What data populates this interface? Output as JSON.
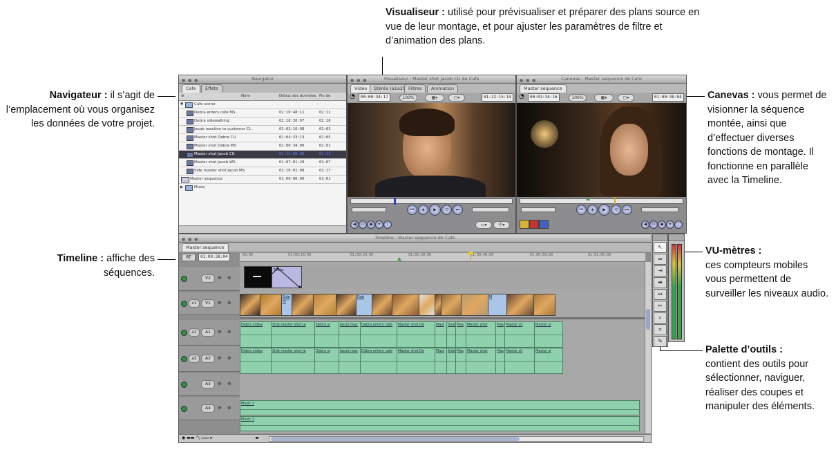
{
  "callouts": {
    "visualiseur": {
      "title": "Visualiseur :",
      "text": "utilisé pour prévisualiser et préparer des plans source en vue de leur montage, et pour ajuster les paramètres de filtre et d’animation des plans."
    },
    "navigateur": {
      "title": "Navigateur :",
      "text": "il s’agit de l’emplacement où vous organisez les données de votre projet."
    },
    "canevas": {
      "title": "Canevas :",
      "text": "vous permet de visionner la séquence montée, ainsi que d’effectuer diverses fonctions de montage. Il fonctionne en parallèle avec la Timeline."
    },
    "timeline": {
      "title": "Timeline :",
      "text": "affiche des séquences."
    },
    "vumetres": {
      "title": "VU-mètres :",
      "text": "ces compteurs mobiles vous permettent de surveiller les niveaux audio."
    },
    "palette": {
      "title": "Palette d’outils :",
      "text": "contient des outils pour sélectionner, naviguer, réaliser des coupes et manipuler des éléments."
    }
  },
  "browser": {
    "title": "Navigator",
    "tabs": [
      "Cafe",
      "Effets"
    ],
    "columns": {
      "name": "Nom",
      "date": "Début des données",
      "fin": "Fin de"
    },
    "bin_name": "Cafe scene",
    "rows": [
      {
        "name": "Debra enters cafe MS",
        "start": "02:10:48:11",
        "end": "02:11"
      },
      {
        "name": "Debra sidewalking",
        "start": "02:18:30:07",
        "end": "02:18"
      },
      {
        "name": "Jacob reaction to customer CL",
        "start": "01:03:16:08",
        "end": "01:03"
      },
      {
        "name": "Master shot Debra CU",
        "start": "02:04:33:13",
        "end": "02:05"
      },
      {
        "name": "Master shot Debra MS",
        "start": "02:00:34:00",
        "end": "02:01"
      },
      {
        "name": "Master shot Jacob CU",
        "start": "01:12:00:00",
        "end": "01:12"
      },
      {
        "name": "Master shot Jacob WS",
        "start": "01:07:01:20",
        "end": "01:07"
      },
      {
        "name": "Side master shot Jacob MS",
        "start": "01:16:01:08",
        "end": "01:17"
      }
    ],
    "sequence": {
      "name": "Master sequence",
      "start": "01:00:00:00",
      "end": "01:01"
    },
    "music": "Music"
  },
  "viewer": {
    "title": "Visualiseur : Master shot Jacob CU de Cafe",
    "tabs": [
      "Vidéo",
      "Stéréo (a1a2)",
      "Filtres",
      "Animation"
    ],
    "tc_left": "00:00:34:17",
    "tc_right": "01:12:15:14",
    "zoom": "100%"
  },
  "canvas": {
    "title": "Canevas : Master sequence de Cafe",
    "tab": "Master sequence",
    "tc_left": "00:01:34:16",
    "tc_right": "01:00:38:04",
    "zoom": "100%"
  },
  "timeline": {
    "title": "Timeline : Master sequence de Cafe",
    "tab": "Master sequence",
    "rt": "RT",
    "tc": "01:00:38:04",
    "ticks": [
      "00:00",
      "01:00:16:00",
      "01:00:20:00",
      "01:00:30:00",
      "01:00:40:00",
      "01:00:50:00",
      "01:01:00:00"
    ],
    "tracks": [
      {
        "src": "",
        "dst": "V2"
      },
      {
        "src": "v1",
        "dst": "V1"
      },
      {
        "src": "a1",
        "dst": "A1"
      },
      {
        "src": "a2",
        "dst": "A2"
      },
      {
        "src": "",
        "dst": "A3"
      },
      {
        "src": "",
        "dst": "A4"
      }
    ],
    "v2_clip": "Texte",
    "v1_labels": [
      "Side m",
      "Deb",
      "M",
      "M"
    ],
    "audio_clips": [
      "Debra sidew",
      "Side master shot Ja",
      "Debra si",
      "Jacob reac",
      "Debra enters cafe",
      "Master shot De",
      "Mast",
      "Side",
      "Mas",
      "Master shot",
      "Mas",
      "Master sh",
      "Master sl"
    ],
    "music_label": "Music 1"
  },
  "tools": [
    "select-icon",
    "edit-select-icon",
    "track-select-icon",
    "roll-icon",
    "slip-icon",
    "razor-icon",
    "zoom-icon",
    "crop-icon",
    "pen-icon"
  ]
}
